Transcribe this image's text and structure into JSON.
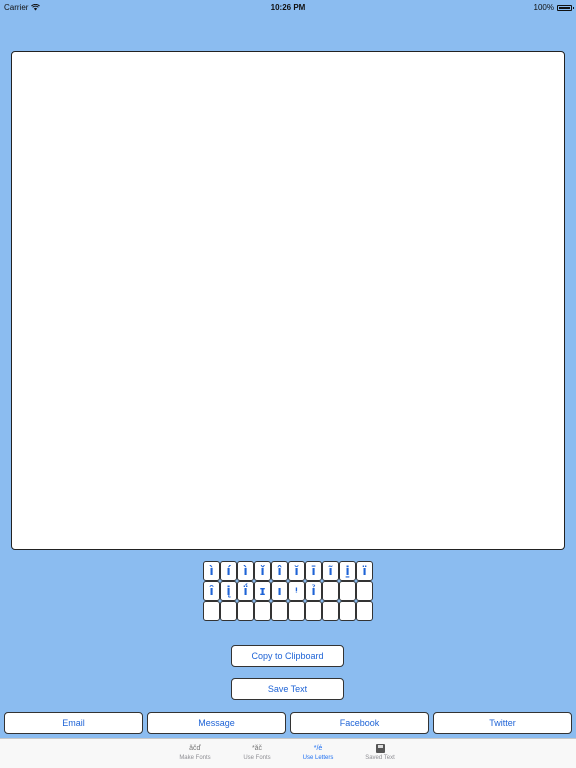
{
  "status_bar": {
    "carrier": "Carrier",
    "time": "10:26 PM",
    "battery": "100%"
  },
  "editor": {
    "text": ""
  },
  "letters": {
    "row1": [
      "ì",
      "í",
      "ì",
      "ǐ",
      "î",
      "ĭ",
      "ī",
      "ĩ",
      "i̱",
      "ï"
    ],
    "row2": [
      "ȋ",
      "į",
      "ḯ",
      "ɪ",
      "ı",
      "ᵎ",
      "ỉ",
      "",
      "",
      ""
    ],
    "row3": [
      "",
      "",
      "",
      "",
      "",
      "",
      "",
      "",
      "",
      ""
    ]
  },
  "buttons": {
    "copy": "Copy to Clipboard",
    "save": "Save Text"
  },
  "share": {
    "email": "Email",
    "message": "Message",
    "facebook": "Facebook",
    "twitter": "Twitter"
  },
  "tabs": [
    {
      "label": "Make Fonts",
      "icon": "ăčď"
    },
    {
      "label": "Use Fonts",
      "icon": "*ăč"
    },
    {
      "label": "Use Letters",
      "icon": "*/é"
    },
    {
      "label": "Saved Text",
      "icon": "floppy-disk-icon"
    }
  ],
  "colors": {
    "background": "#8bbcf0",
    "accent": "#1e63d6",
    "tab_active": "#1e6ff0"
  }
}
